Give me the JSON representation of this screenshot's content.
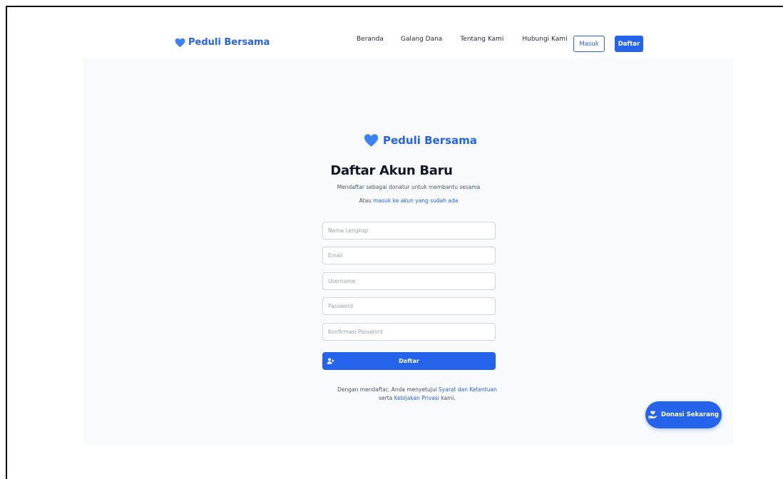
{
  "brand": {
    "name": "Peduli Bersama",
    "icon": "heart-icon",
    "color": "#2563eb"
  },
  "nav": {
    "links": [
      "Beranda",
      "Galang Dana",
      "Tentang Kami",
      "Hubungi Kami"
    ],
    "login_label": "Masuk",
    "register_label": "Daftar"
  },
  "form": {
    "brand_name": "Peduli Bersama",
    "title": "Daftar Akun Baru",
    "subtitle": "Mendaftar sebagai donatur untuk membantu sesama",
    "login_prefix": "Atau",
    "login_link": "masuk ke akun yang sudah ada",
    "fields": {
      "full_name": {
        "placeholder": "Nama Lengkap",
        "value": ""
      },
      "email": {
        "placeholder": "Email",
        "value": ""
      },
      "username": {
        "placeholder": "Username",
        "value": ""
      },
      "password": {
        "placeholder": "Password",
        "value": ""
      },
      "confirm_password": {
        "placeholder": "Konfirmasi Password",
        "value": ""
      }
    },
    "submit_label": "Daftar",
    "submit_icon": "user-plus-icon",
    "terms": {
      "prefix": "Dengan mendaftar, Anda menyetujui",
      "terms_link": "Syarat dan Ketentuan",
      "middle": "serta",
      "privacy_link": "Kebijakan Privasi",
      "suffix": "kami."
    }
  },
  "floating": {
    "donate_label": "Donasi Sekarang",
    "icon": "hand-heart-icon"
  },
  "colors": {
    "primary": "#2563eb",
    "panel_bg": "#f8fafc",
    "text": "#1f2937"
  }
}
